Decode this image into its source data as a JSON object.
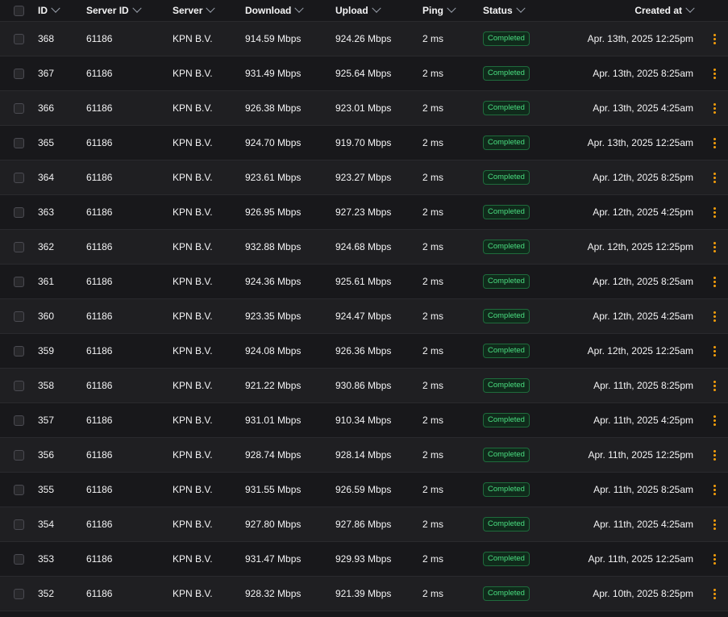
{
  "columns": {
    "id": "ID",
    "server_id": "Server ID",
    "server": "Server",
    "download": "Download",
    "upload": "Upload",
    "ping": "Ping",
    "status": "Status",
    "created_at": "Created at"
  },
  "colors": {
    "background": "#18181b",
    "row_alt": "#1f1f22",
    "badge_text": "#4ade80",
    "kebab": "#f59e0b"
  },
  "rows": [
    {
      "id": "368",
      "server_id": "61186",
      "server": "KPN B.V.",
      "download": "914.59 Mbps",
      "upload": "924.26 Mbps",
      "ping": "2 ms",
      "status": "Completed",
      "created_at": "Apr. 13th, 2025 12:25pm"
    },
    {
      "id": "367",
      "server_id": "61186",
      "server": "KPN B.V.",
      "download": "931.49 Mbps",
      "upload": "925.64 Mbps",
      "ping": "2 ms",
      "status": "Completed",
      "created_at": "Apr. 13th, 2025 8:25am"
    },
    {
      "id": "366",
      "server_id": "61186",
      "server": "KPN B.V.",
      "download": "926.38 Mbps",
      "upload": "923.01 Mbps",
      "ping": "2 ms",
      "status": "Completed",
      "created_at": "Apr. 13th, 2025 4:25am"
    },
    {
      "id": "365",
      "server_id": "61186",
      "server": "KPN B.V.",
      "download": "924.70 Mbps",
      "upload": "919.70 Mbps",
      "ping": "2 ms",
      "status": "Completed",
      "created_at": "Apr. 13th, 2025 12:25am"
    },
    {
      "id": "364",
      "server_id": "61186",
      "server": "KPN B.V.",
      "download": "923.61 Mbps",
      "upload": "923.27 Mbps",
      "ping": "2 ms",
      "status": "Completed",
      "created_at": "Apr. 12th, 2025 8:25pm"
    },
    {
      "id": "363",
      "server_id": "61186",
      "server": "KPN B.V.",
      "download": "926.95 Mbps",
      "upload": "927.23 Mbps",
      "ping": "2 ms",
      "status": "Completed",
      "created_at": "Apr. 12th, 2025 4:25pm"
    },
    {
      "id": "362",
      "server_id": "61186",
      "server": "KPN B.V.",
      "download": "932.88 Mbps",
      "upload": "924.68 Mbps",
      "ping": "2 ms",
      "status": "Completed",
      "created_at": "Apr. 12th, 2025 12:25pm"
    },
    {
      "id": "361",
      "server_id": "61186",
      "server": "KPN B.V.",
      "download": "924.36 Mbps",
      "upload": "925.61 Mbps",
      "ping": "2 ms",
      "status": "Completed",
      "created_at": "Apr. 12th, 2025 8:25am"
    },
    {
      "id": "360",
      "server_id": "61186",
      "server": "KPN B.V.",
      "download": "923.35 Mbps",
      "upload": "924.47 Mbps",
      "ping": "2 ms",
      "status": "Completed",
      "created_at": "Apr. 12th, 2025 4:25am"
    },
    {
      "id": "359",
      "server_id": "61186",
      "server": "KPN B.V.",
      "download": "924.08 Mbps",
      "upload": "926.36 Mbps",
      "ping": "2 ms",
      "status": "Completed",
      "created_at": "Apr. 12th, 2025 12:25am"
    },
    {
      "id": "358",
      "server_id": "61186",
      "server": "KPN B.V.",
      "download": "921.22 Mbps",
      "upload": "930.86 Mbps",
      "ping": "2 ms",
      "status": "Completed",
      "created_at": "Apr. 11th, 2025 8:25pm"
    },
    {
      "id": "357",
      "server_id": "61186",
      "server": "KPN B.V.",
      "download": "931.01 Mbps",
      "upload": "910.34 Mbps",
      "ping": "2 ms",
      "status": "Completed",
      "created_at": "Apr. 11th, 2025 4:25pm"
    },
    {
      "id": "356",
      "server_id": "61186",
      "server": "KPN B.V.",
      "download": "928.74 Mbps",
      "upload": "928.14 Mbps",
      "ping": "2 ms",
      "status": "Completed",
      "created_at": "Apr. 11th, 2025 12:25pm"
    },
    {
      "id": "355",
      "server_id": "61186",
      "server": "KPN B.V.",
      "download": "931.55 Mbps",
      "upload": "926.59 Mbps",
      "ping": "2 ms",
      "status": "Completed",
      "created_at": "Apr. 11th, 2025 8:25am"
    },
    {
      "id": "354",
      "server_id": "61186",
      "server": "KPN B.V.",
      "download": "927.80 Mbps",
      "upload": "927.86 Mbps",
      "ping": "2 ms",
      "status": "Completed",
      "created_at": "Apr. 11th, 2025 4:25am"
    },
    {
      "id": "353",
      "server_id": "61186",
      "server": "KPN B.V.",
      "download": "931.47 Mbps",
      "upload": "929.93 Mbps",
      "ping": "2 ms",
      "status": "Completed",
      "created_at": "Apr. 11th, 2025 12:25am"
    },
    {
      "id": "352",
      "server_id": "61186",
      "server": "KPN B.V.",
      "download": "928.32 Mbps",
      "upload": "921.39 Mbps",
      "ping": "2 ms",
      "status": "Completed",
      "created_at": "Apr. 10th, 2025 8:25pm"
    }
  ]
}
